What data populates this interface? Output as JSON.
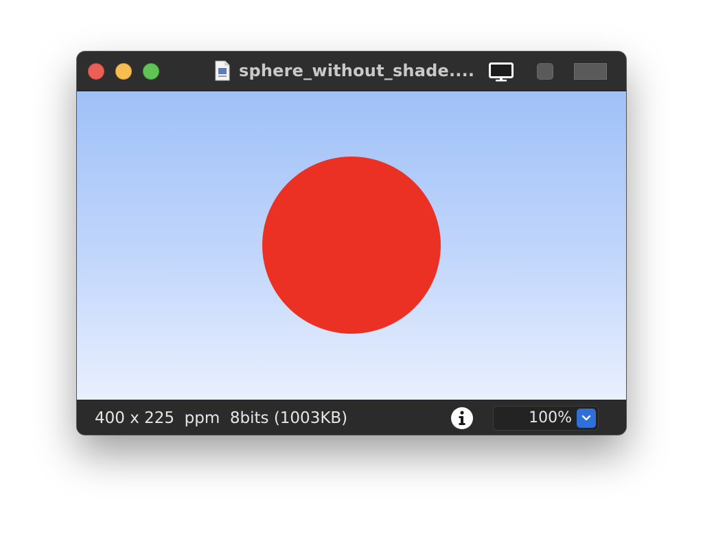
{
  "window": {
    "title": "sphere_without_shade....",
    "accent": "#2f6fd9"
  },
  "titlebar": {
    "buttons": [
      "close-button",
      "minimize-button",
      "zoom-button"
    ],
    "icons": [
      "document-icon",
      "monitor-icon",
      "square-icon",
      "rectangle-icon"
    ]
  },
  "image": {
    "background_top": "#9fc0f8",
    "background_bottom": "#e9f0fe",
    "sphere_color": "#ea3123"
  },
  "statusbar": {
    "info": "400 x 225  ppm  8bits (1003KB)",
    "info_icon": "info-icon",
    "zoom": "100%",
    "zoom_dropdown_icon": "chevron-down-icon"
  }
}
